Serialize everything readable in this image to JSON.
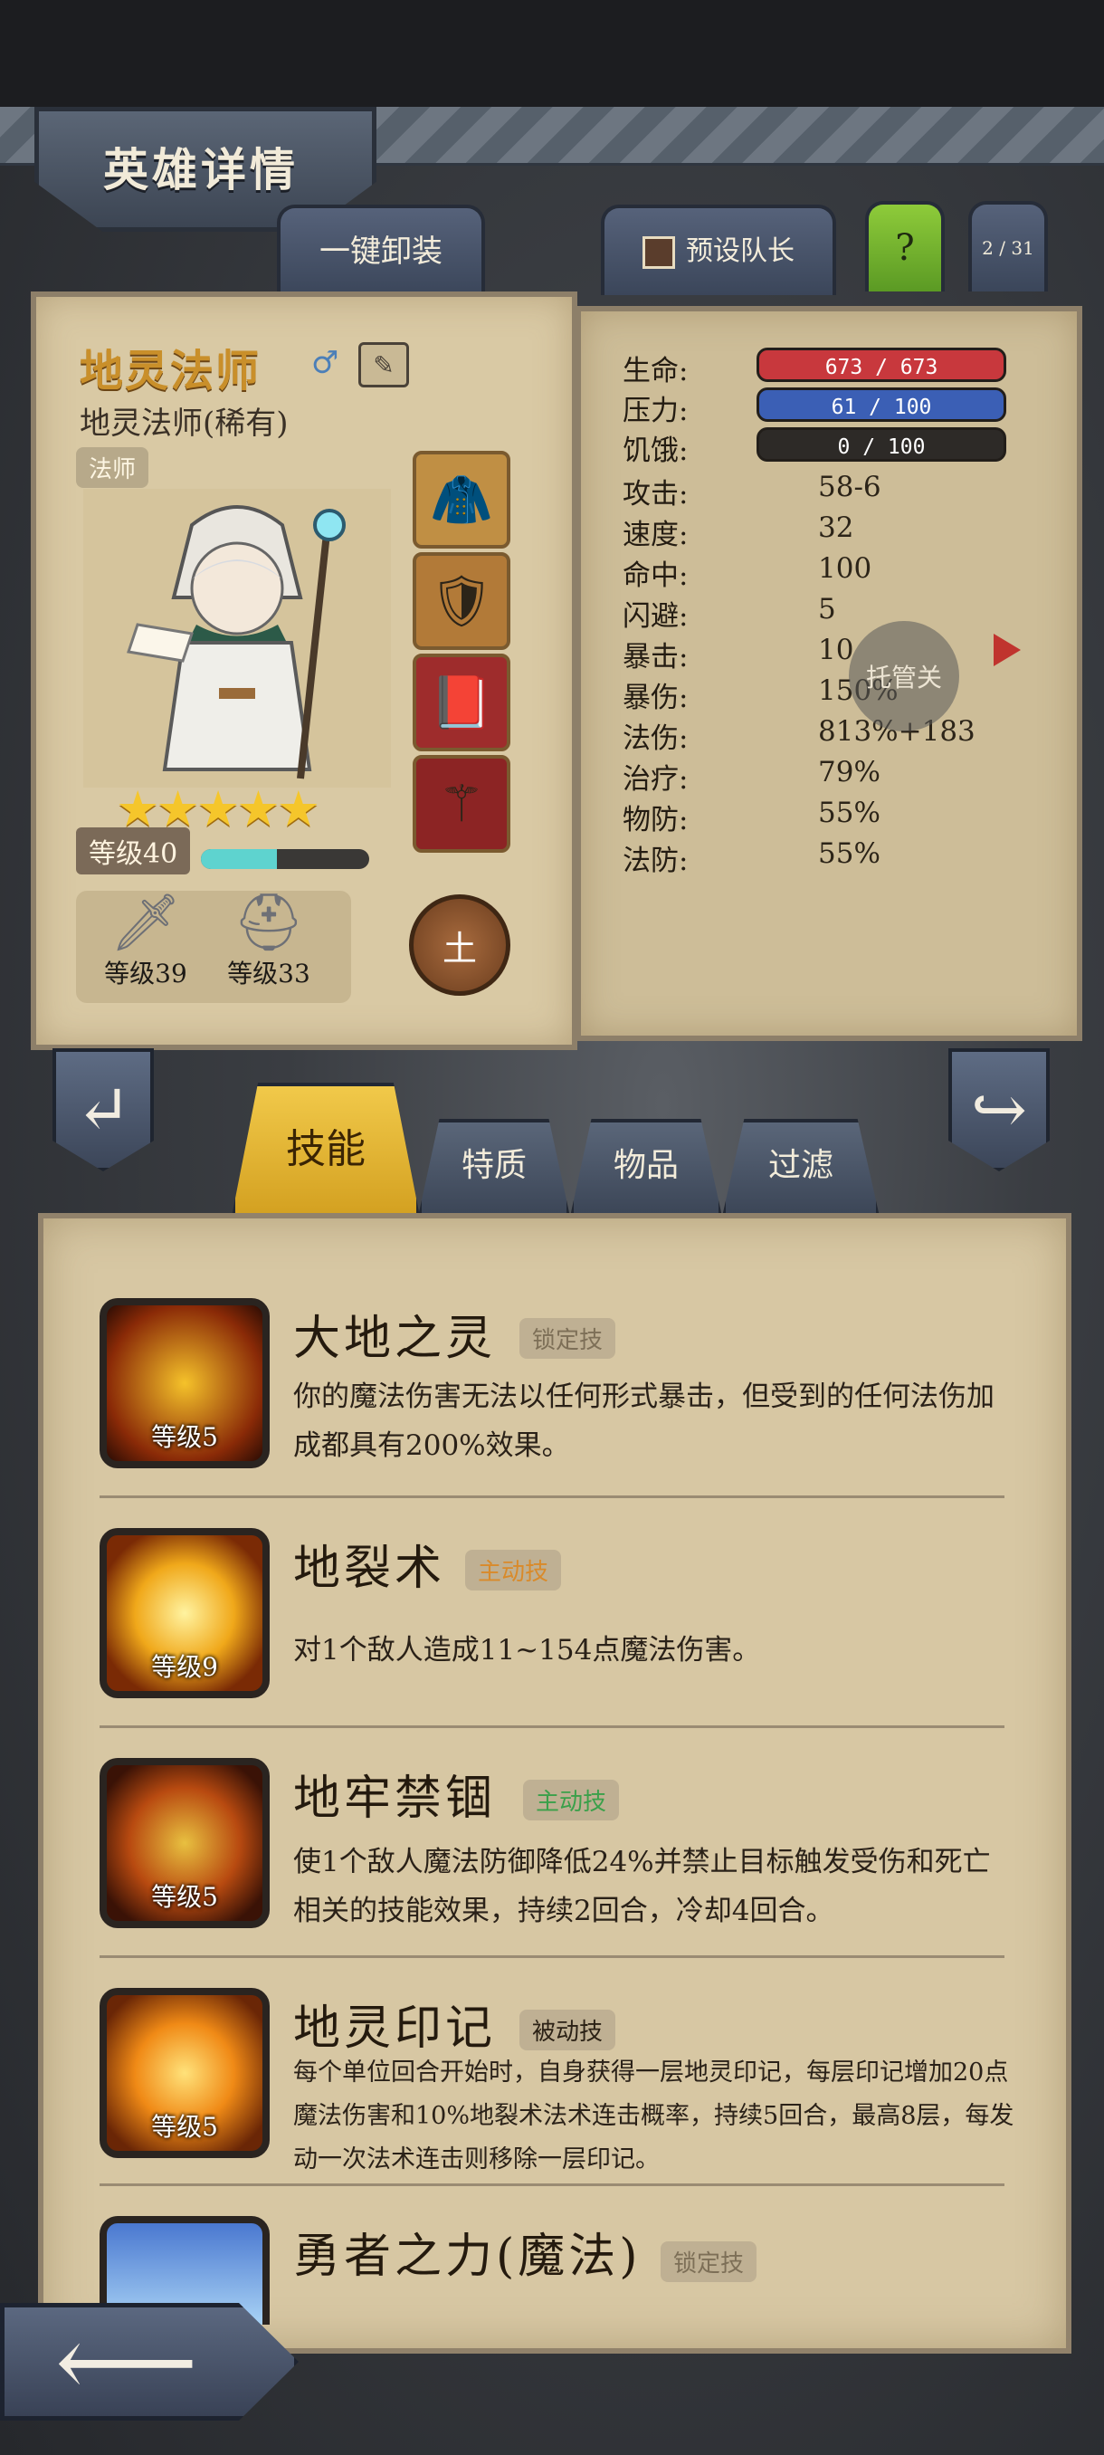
{
  "header": {
    "title": "英雄详情"
  },
  "top_tabs": {
    "unequip_all": "一键卸装",
    "preset_captain": "预设队长",
    "help": "?",
    "page_indicator": "2 / 31"
  },
  "hero": {
    "name": "地灵法师",
    "subtitle": "地灵法师(稀有)",
    "class_badge": "法师",
    "stars": 5,
    "level_label": "等级40",
    "xp_fraction": 0.45,
    "element_label": "土",
    "gear": [
      {
        "icon": "sword-icon",
        "label": "等级39"
      },
      {
        "icon": "helmet-icon",
        "label": "等级33"
      }
    ]
  },
  "equipment_slots": [
    "hood-icon",
    "shield-icon",
    "spellbook-icon",
    "staff-icon"
  ],
  "stats": {
    "hp": {
      "label": "生命:",
      "value": "673 / 673",
      "color": "#c8383d"
    },
    "stress": {
      "label": "压力:",
      "value": "61 / 100",
      "color": "#3b5fb5"
    },
    "hunger": {
      "label": "饥饿:",
      "value": "0 / 100",
      "color": "#2d2a27"
    },
    "rows": [
      {
        "label": "攻击:",
        "value": "58-6"
      },
      {
        "label": "速度:",
        "value": "32"
      },
      {
        "label": "命中:",
        "value": "100"
      },
      {
        "label": "闪避:",
        "value": "5"
      },
      {
        "label": "暴击:",
        "value": "10"
      },
      {
        "label": "暴伤:",
        "value": "150%"
      },
      {
        "label": "法伤:",
        "value": "813%+183"
      },
      {
        "label": "治疗:",
        "value": "79%"
      },
      {
        "label": "物防:",
        "value": "55%"
      },
      {
        "label": "法防:",
        "value": "55%"
      }
    ]
  },
  "autopilot": {
    "label": "托管关"
  },
  "tabs": {
    "skills": "技能",
    "traits": "特质",
    "items": "物品",
    "filter": "过滤"
  },
  "skills": [
    {
      "name": "大地之灵",
      "tag": "锁定技",
      "tag_color": "#7d6f57",
      "level": "等级5",
      "desc": "你的魔法伤害无法以任何形式暴击，但受到的任何法伤加成都具有200%效果。"
    },
    {
      "name": "地裂术",
      "tag": "主动技",
      "tag_color": "#d98a2a",
      "level": "等级9",
      "desc": "对1个敌人造成11~154点魔法伤害。"
    },
    {
      "name": "地牢禁锢",
      "tag": "主动技",
      "tag_color": "#3aa04a",
      "level": "等级5",
      "desc": "使1个敌人魔法防御降低24%并禁止目标触发受伤和死亡相关的技能效果，持续2回合，冷却4回合。"
    },
    {
      "name": "地灵印记",
      "tag": "被动技",
      "tag_color": "#2b2115",
      "level": "等级5",
      "desc": "每个单位回合开始时，自身获得一层地灵印记，每层印记增加20点魔法伤害和10%地裂术法术连击概率，持续5回合，最高8层，每发动一次法术连击则移除一层印记。"
    },
    {
      "name": "勇者之力(魔法)",
      "tag": "锁定技",
      "tag_color": "#7d6f57",
      "level": ""
    }
  ],
  "nav": {
    "prev": "↵",
    "next": "↪",
    "back": "⟵"
  }
}
